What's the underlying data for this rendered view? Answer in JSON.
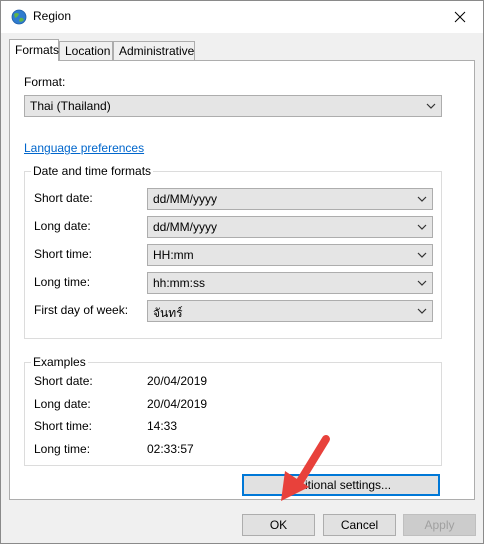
{
  "window": {
    "title": "Region"
  },
  "tabs": [
    {
      "label": "Formats"
    },
    {
      "label": "Location"
    },
    {
      "label": "Administrative"
    }
  ],
  "format": {
    "label": "Format:",
    "value": "Thai (Thailand)"
  },
  "language_link": "Language preferences",
  "date_time_formats": {
    "title": "Date and time formats",
    "rows": [
      {
        "label": "Short date:",
        "value": "dd/MM/yyyy"
      },
      {
        "label": "Long date:",
        "value": "dd/MM/yyyy"
      },
      {
        "label": "Short time:",
        "value": "HH:mm"
      },
      {
        "label": "Long time:",
        "value": "hh:mm:ss"
      },
      {
        "label": "First day of week:",
        "value": "จันทร์"
      }
    ]
  },
  "examples": {
    "title": "Examples",
    "rows": [
      {
        "label": "Short date:",
        "value": "20/04/2019"
      },
      {
        "label": "Long date:",
        "value": "20/04/2019"
      },
      {
        "label": "Short time:",
        "value": "14:33"
      },
      {
        "label": "Long time:",
        "value": "02:33:57"
      }
    ]
  },
  "additional_settings": {
    "visible_label": "itional settings..."
  },
  "buttons": {
    "ok": "OK",
    "cancel": "Cancel",
    "apply": "Apply"
  },
  "colors": {
    "link": "#0066cc",
    "focus": "#0078d7",
    "arrow": "#e8413b"
  },
  "icons": {
    "title": "globe-icon",
    "close": "close-icon",
    "chevron": "chevron-down-icon",
    "annotation": "red-arrow-icon"
  }
}
